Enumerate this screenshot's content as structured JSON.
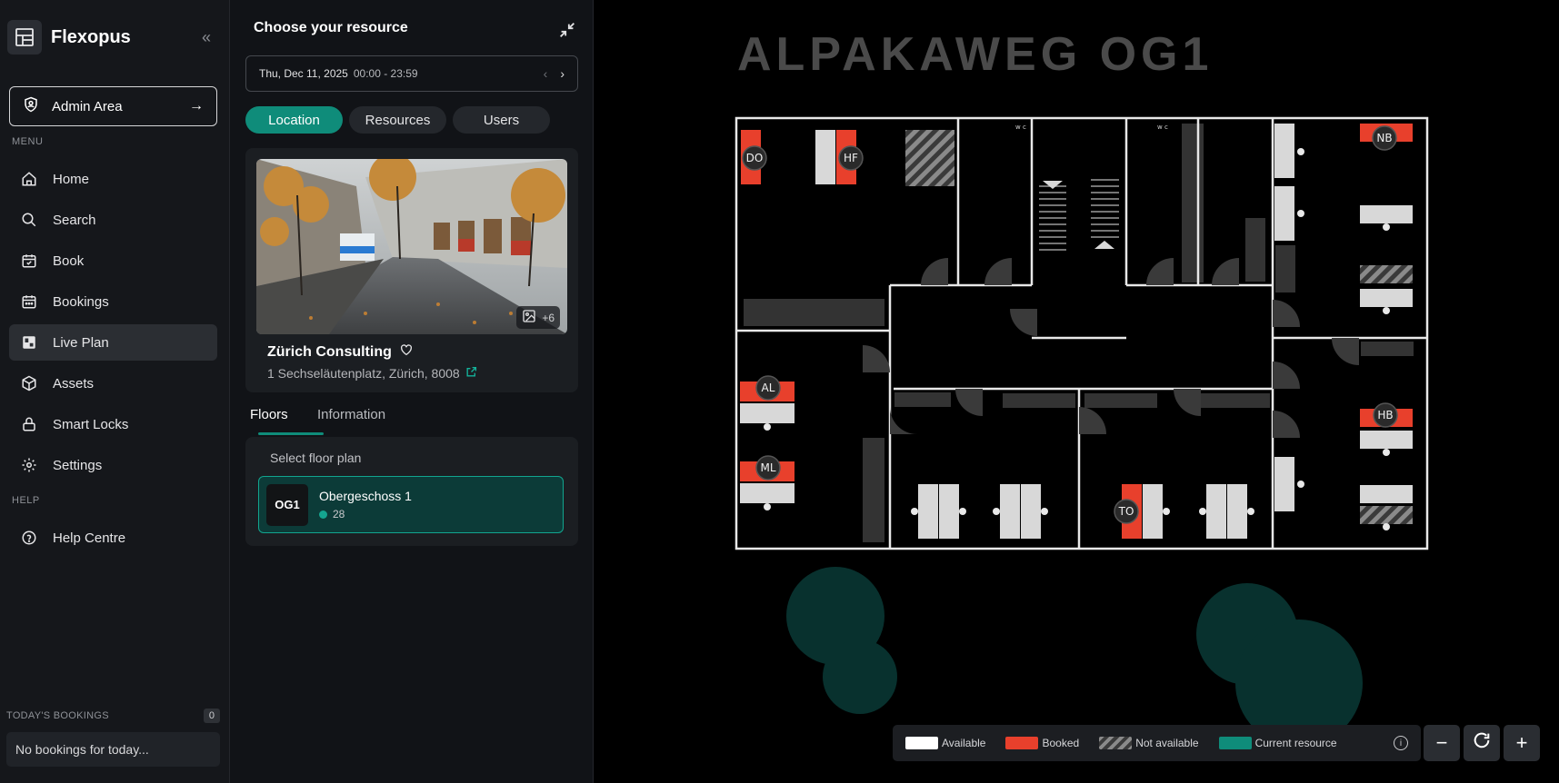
{
  "sidebar": {
    "brand": "Flexopus",
    "admin_label": "Admin Area",
    "menu_label": "MENU",
    "help_label": "HELP",
    "items": [
      {
        "label": "Home",
        "icon": "home-icon"
      },
      {
        "label": "Search",
        "icon": "search-icon"
      },
      {
        "label": "Book",
        "icon": "calendar-check-icon"
      },
      {
        "label": "Bookings",
        "icon": "calendar-icon"
      },
      {
        "label": "Live Plan",
        "icon": "floorplan-icon"
      },
      {
        "label": "Assets",
        "icon": "box-icon"
      },
      {
        "label": "Smart Locks",
        "icon": "lock-icon"
      },
      {
        "label": "Settings",
        "icon": "gear-icon"
      }
    ],
    "help_items": [
      {
        "label": "Help Centre",
        "icon": "help-icon"
      }
    ],
    "todays_label": "TODAY'S BOOKINGS",
    "todays_count": "0",
    "no_bookings": "No bookings for today..."
  },
  "panel": {
    "title": "Choose your resource",
    "date": "Thu, Dec 11, 2025",
    "time": "00:00 - 23:59",
    "segments": [
      "Location",
      "Resources",
      "Users"
    ],
    "photo_count": "+6",
    "location_name": "Zürich Consulting",
    "location_address": "1 Sechseläutenplatz, Zürich, 8008",
    "tabs": [
      "Floors",
      "Information"
    ],
    "floor_select_label": "Select floor plan",
    "floor_code": "OG1",
    "floor_name": "Obergeschoss 1",
    "floor_count": "28"
  },
  "map": {
    "title": "ALPAKAWEG OG1",
    "wc": "w c",
    "desks": [
      {
        "initials": "DO"
      },
      {
        "initials": "HF"
      },
      {
        "initials": "NB"
      },
      {
        "initials": "AL"
      },
      {
        "initials": "ML"
      },
      {
        "initials": "HB"
      },
      {
        "initials": "TO"
      }
    ]
  },
  "legend": {
    "available": "Available",
    "booked": "Booked",
    "not_available": "Not available",
    "current": "Current resource"
  },
  "colors": {
    "accent": "#0f8c7a",
    "booked": "#e8402c",
    "available": "#ffffff"
  }
}
